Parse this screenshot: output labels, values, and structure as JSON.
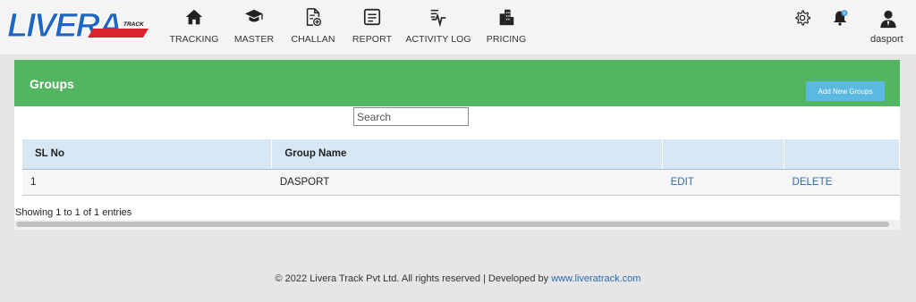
{
  "brand": {
    "logo_text": "LIVERA",
    "logo_sub": "TRACK"
  },
  "nav": [
    {
      "label": "TRACKING",
      "icon": "home-icon"
    },
    {
      "label": "MASTER",
      "icon": "graduation-cap-icon"
    },
    {
      "label": "CHALLAN",
      "icon": "document-add-icon"
    },
    {
      "label": "REPORT",
      "icon": "report-icon"
    },
    {
      "label": "ACTIVITY LOG",
      "icon": "activity-log-icon"
    },
    {
      "label": "PRICING",
      "icon": "buildings-icon"
    }
  ],
  "header_right": {
    "user_name": "dasport",
    "notification_count": "0"
  },
  "panel": {
    "title": "Groups",
    "add_button": "Add New Groups",
    "search_placeholder": "Search"
  },
  "table": {
    "columns": [
      "SL No",
      "Group Name",
      "",
      ""
    ],
    "rows": [
      {
        "sl": "1",
        "name": "DASPORT",
        "edit": "EDIT",
        "delete": "DELETE"
      }
    ]
  },
  "entries_text": "Showing 1 to 1 of 1 entries",
  "footer": {
    "text": "© 2022 Livera Track Pvt Ltd. All rights reserved | Developed by",
    "link": "www.liveratrack.com"
  },
  "colors": {
    "header_green": "#53b462",
    "button_blue": "#5bb8e0",
    "link_blue": "#2b6bb3",
    "logo_blue": "#1e66c6",
    "logo_red": "#d8262c"
  }
}
